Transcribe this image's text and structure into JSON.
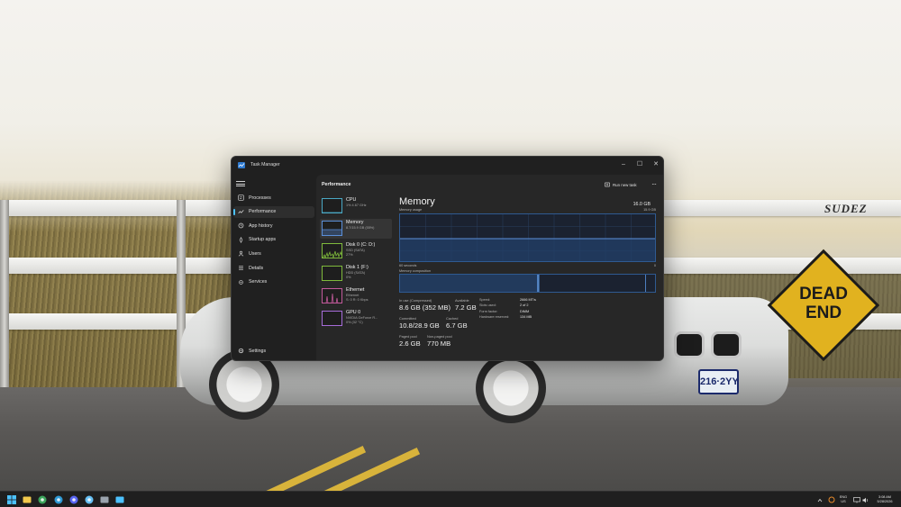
{
  "window": {
    "title": "Task Manager",
    "controls": {
      "minimize": "–",
      "maximize": "☐",
      "close": "✕"
    }
  },
  "nav": {
    "items": [
      {
        "label": "Processes",
        "icon": "processes-icon",
        "active": false
      },
      {
        "label": "Performance",
        "icon": "performance-icon",
        "active": true
      },
      {
        "label": "App history",
        "icon": "app-history-icon",
        "active": false
      },
      {
        "label": "Startup apps",
        "icon": "startup-apps-icon",
        "active": false
      },
      {
        "label": "Users",
        "icon": "users-icon",
        "active": false
      },
      {
        "label": "Details",
        "icon": "details-icon",
        "active": false
      },
      {
        "label": "Services",
        "icon": "services-icon",
        "active": false
      }
    ],
    "settings_label": "Settings"
  },
  "header": {
    "title": "Performance",
    "run_task_label": "Run new task",
    "more_label": "···"
  },
  "devices": [
    {
      "name": "CPU",
      "line1": "1% 4.67 GHz",
      "line2": "",
      "color": "#4aa8c4"
    },
    {
      "name": "Memory",
      "line1": "8.7/15.9 GB (55%)",
      "line2": "",
      "color": "#5b8fd9"
    },
    {
      "name": "Disk 0 (C: D:)",
      "line1": "SSD (SATA)",
      "line2": "27%",
      "color": "#7fba3c"
    },
    {
      "name": "Disk 1 (F:)",
      "line1": "HDD (SATA)",
      "line2": "0%",
      "color": "#7fba3c"
    },
    {
      "name": "Ethernet",
      "line1": "Ethernet",
      "line2": "S: 0 R: 0 Kbps",
      "color": "#c25a9b"
    },
    {
      "name": "GPU 0",
      "line1": "NVIDIA GeForce R...",
      "line2": "0% (32 °C)",
      "color": "#a66cd9"
    }
  ],
  "memory": {
    "title": "Memory",
    "total": "16.0 GB",
    "usage_label": "Memory usage",
    "usage_max": "15.9 GB",
    "axis_left": "60 seconds",
    "axis_right": "0",
    "usage_fraction": 0.5,
    "composition_label": "Memory composition",
    "composition": {
      "in_use_fraction": 0.54,
      "modified_fraction": 0.005,
      "standby_fraction": 0.42
    },
    "stats": {
      "in_use": {
        "label": "In use (Compressed)",
        "value": "8.6 GB (352 MB)"
      },
      "available": {
        "label": "Available",
        "value": "7.2 GB"
      },
      "committed": {
        "label": "Committed",
        "value": "10.8/28.9 GB"
      },
      "cached": {
        "label": "Cached",
        "value": "6.7 GB"
      },
      "paged_pool": {
        "label": "Paged pool",
        "value": "2.6 GB"
      },
      "non_paged_pool": {
        "label": "Non-paged pool",
        "value": "770 MB"
      }
    },
    "specs": [
      {
        "label": "Speed:",
        "value": "2666 MT/s"
      },
      {
        "label": "Slots used:",
        "value": "2 of 2"
      },
      {
        "label": "Form factor:",
        "value": "DIMM"
      },
      {
        "label": "Hardware reserved:",
        "value": "134 MB"
      }
    ]
  },
  "wallpaper": {
    "sign_line1": "DEAD",
    "sign_line2": "END",
    "plate": "216·2YY",
    "graffiti": "SUDEZ"
  },
  "taskbar": {
    "pinned": [
      {
        "icon": "start-icon",
        "color": "#4cc2ff"
      },
      {
        "icon": "file-explorer-icon",
        "color": "#f2c94c"
      },
      {
        "icon": "chrome-icon",
        "color": "#3ca55c"
      },
      {
        "icon": "edge-icon",
        "color": "#2f9ad6"
      },
      {
        "icon": "discord-icon",
        "color": "#5865f2"
      },
      {
        "icon": "steam-icon",
        "color": "#66c0f4"
      },
      {
        "icon": "app-icon",
        "color": "#9aa3ad"
      },
      {
        "icon": "task-manager-icon",
        "color": "#4cc2ff"
      }
    ],
    "tray": {
      "lang_line1": "ENG",
      "lang_line2": "US",
      "time": "3:08 AM",
      "date": "5/28/2026"
    }
  }
}
